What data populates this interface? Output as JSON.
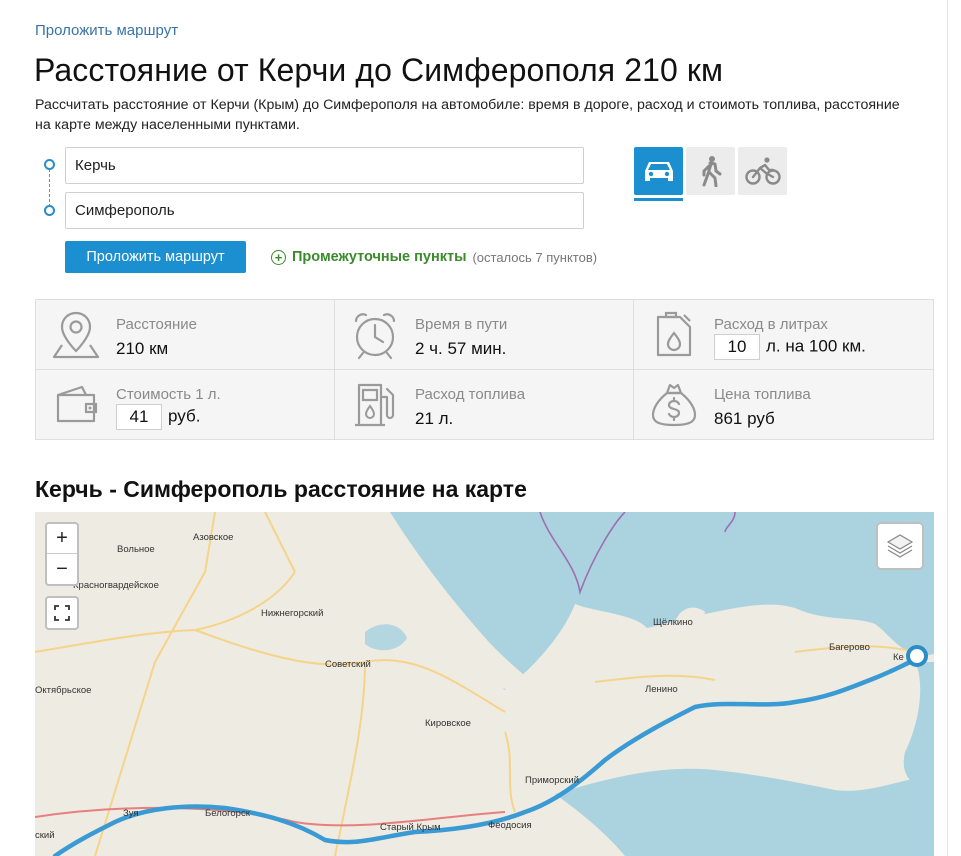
{
  "breadcrumb": "Проложить маршрут",
  "title": "Расстояние от Керчи до Симферополя 210 км",
  "description": "Рассчитать расстояние от Керчи (Крым) до Симферополя на автомобиле: время в дороге, расход и стоимоть топлива, расстояние на карте между населенными пунктами.",
  "route": {
    "from": "Керчь",
    "to": "Симферополь",
    "submit_label": "Проложить маршрут",
    "waypoints_label": "Промежуточные пункты",
    "waypoints_remaining": "(осталось 7 пунктов)",
    "modes": [
      "car-icon",
      "walk-icon",
      "bike-icon"
    ],
    "active_mode": "car"
  },
  "stats": {
    "distance": {
      "label": "Расстояние",
      "value": "210 км"
    },
    "time": {
      "label": "Время в пути",
      "value": "2 ч. 57 мин."
    },
    "consumption": {
      "label": "Расход в литрах",
      "input": "10",
      "suffix": "л. на 100 км."
    },
    "price_per_liter": {
      "label": "Стоимость 1 л.",
      "input": "41",
      "suffix": "руб."
    },
    "fuel_used": {
      "label": "Расход топлива",
      "value": "21 л."
    },
    "fuel_cost": {
      "label": "Цена топлива",
      "value": "861 руб"
    }
  },
  "map": {
    "title": "Керчь - Симферополь расстояние на карте",
    "zoom_in": "+",
    "zoom_out": "−",
    "labels": [
      "Азовское",
      "Вольное",
      "Красногвардейское",
      "Нижнегорский",
      "Советский",
      "Октябрьское",
      "Кировское",
      "Щёлкино",
      "Багерово",
      "Ленино",
      "Приморский",
      "Феодосия",
      "Старый Крым",
      "Белогорск",
      "Зуя",
      "ский",
      "Ке"
    ]
  },
  "colors": {
    "accent": "#1c8fd0",
    "link": "#3a73a8",
    "green": "#3b8a2d",
    "route": "#3a9ad4"
  }
}
